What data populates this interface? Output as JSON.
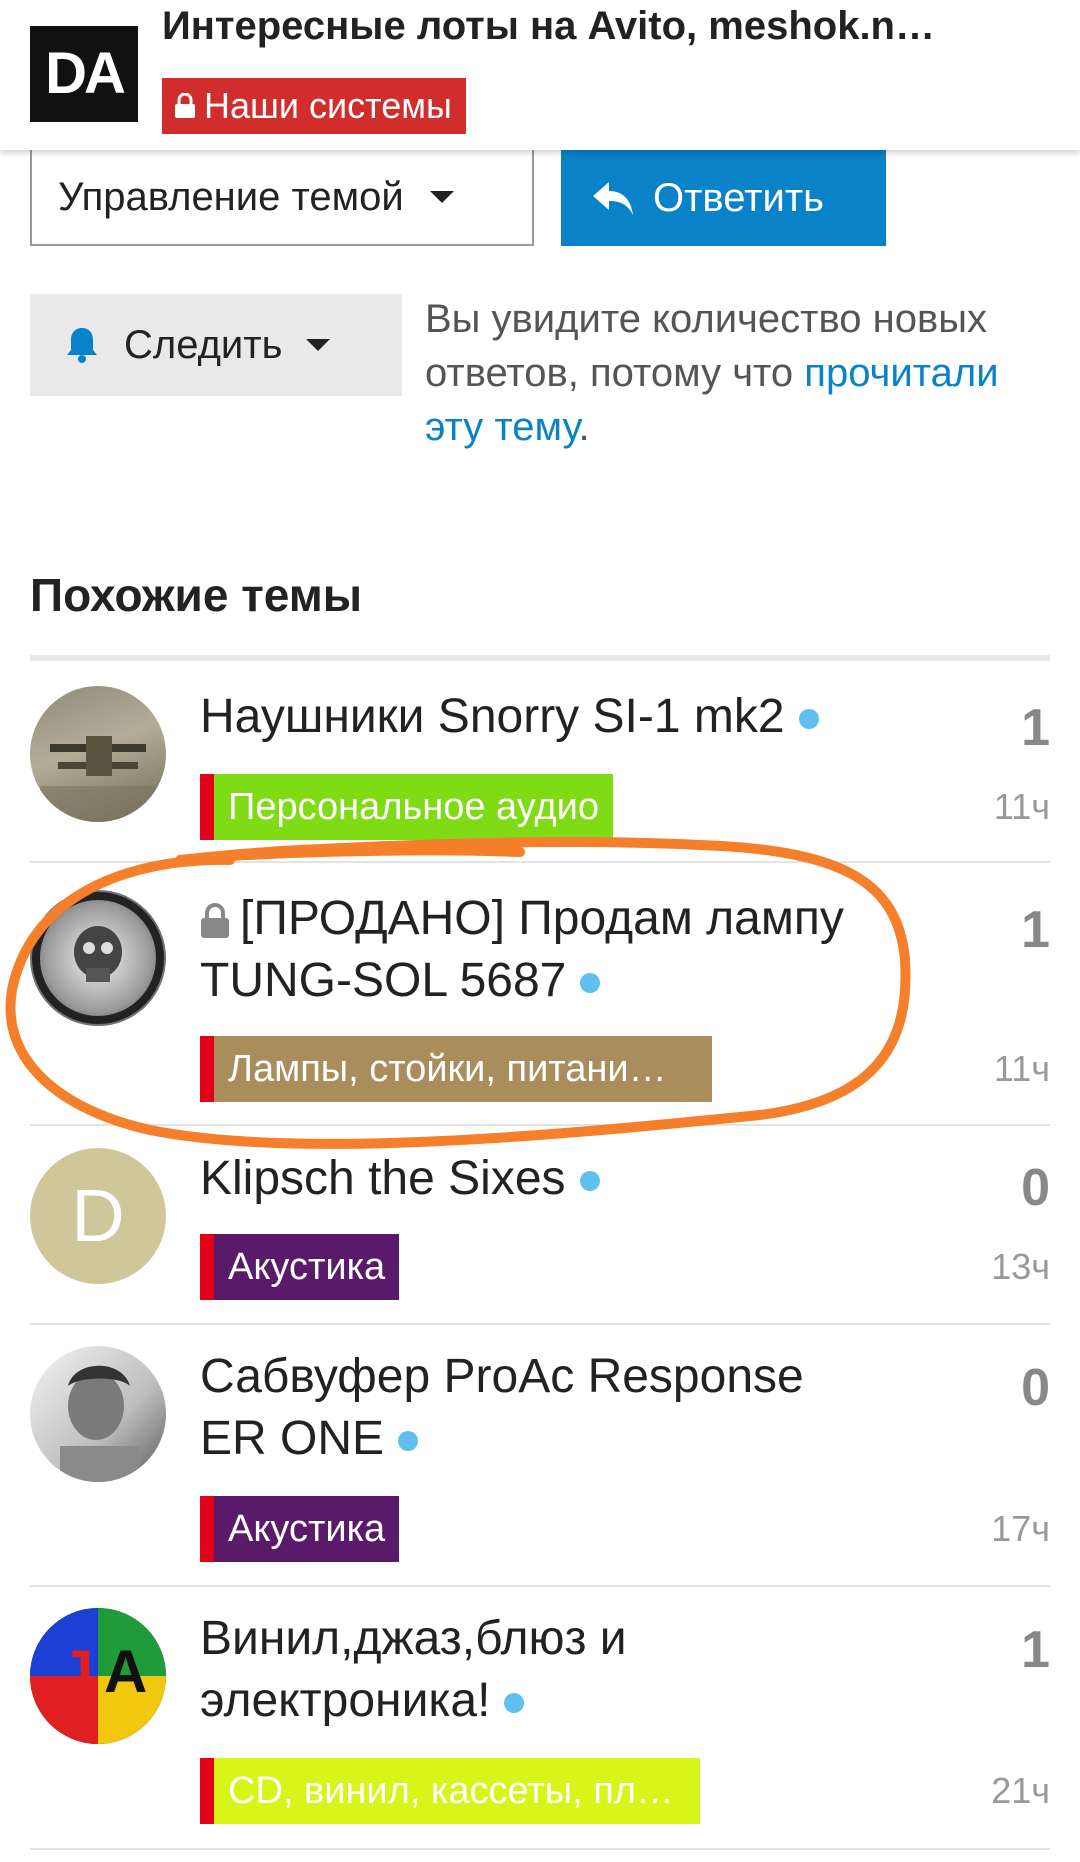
{
  "header": {
    "logo_text": "DA",
    "title": "Интересные лоты на Avito, meshok.n…",
    "category": "Наши системы",
    "category_color": "#d12d2d"
  },
  "actions": {
    "manage_label": "Управление темой",
    "reply_label": "Ответить",
    "watch_label": "Следить",
    "accent_color": "#0a82c8"
  },
  "notice": {
    "text": "Вы увидите количество новых ответов, потому что ",
    "link": "прочитали эту тему",
    "end": "."
  },
  "similar": {
    "title": "Похожие темы",
    "topics": [
      {
        "title": "Наушники Snorry SI-1 mk2",
        "locked": false,
        "tag": "Персональное аудио",
        "tag_color": "#7fdc14",
        "count": "1",
        "age": "11ч",
        "avatar_icon": "biplane-avatar"
      },
      {
        "title": "[ПРОДАНО] Продам лампу TUNG-SOL 5687",
        "locked": true,
        "tag": "Лампы, стойки, питани…",
        "tag_color": "#a98d5c",
        "count": "1",
        "age": "11ч",
        "avatar_icon": "skull-avatar"
      },
      {
        "title": "Klipsch the Sixes",
        "locked": false,
        "tag": "Акустика",
        "tag_color": "#5a1a6a",
        "count": "0",
        "age": "13ч",
        "avatar_letter": "D"
      },
      {
        "title": "Сабвуфер ProAc Response ER ONE",
        "locked": false,
        "tag": "Акустика",
        "tag_color": "#5a1a6a",
        "count": "0",
        "age": "17ч",
        "avatar_icon": "portrait-avatar"
      },
      {
        "title": "Винил,джаз,блюз и электроника!",
        "locked": false,
        "tag": "CD, винил, кассеты, пле…",
        "tag_color": "#d8f51a",
        "count": "1",
        "age": "21ч",
        "avatar_icon": "jazz-avatar"
      }
    ]
  }
}
